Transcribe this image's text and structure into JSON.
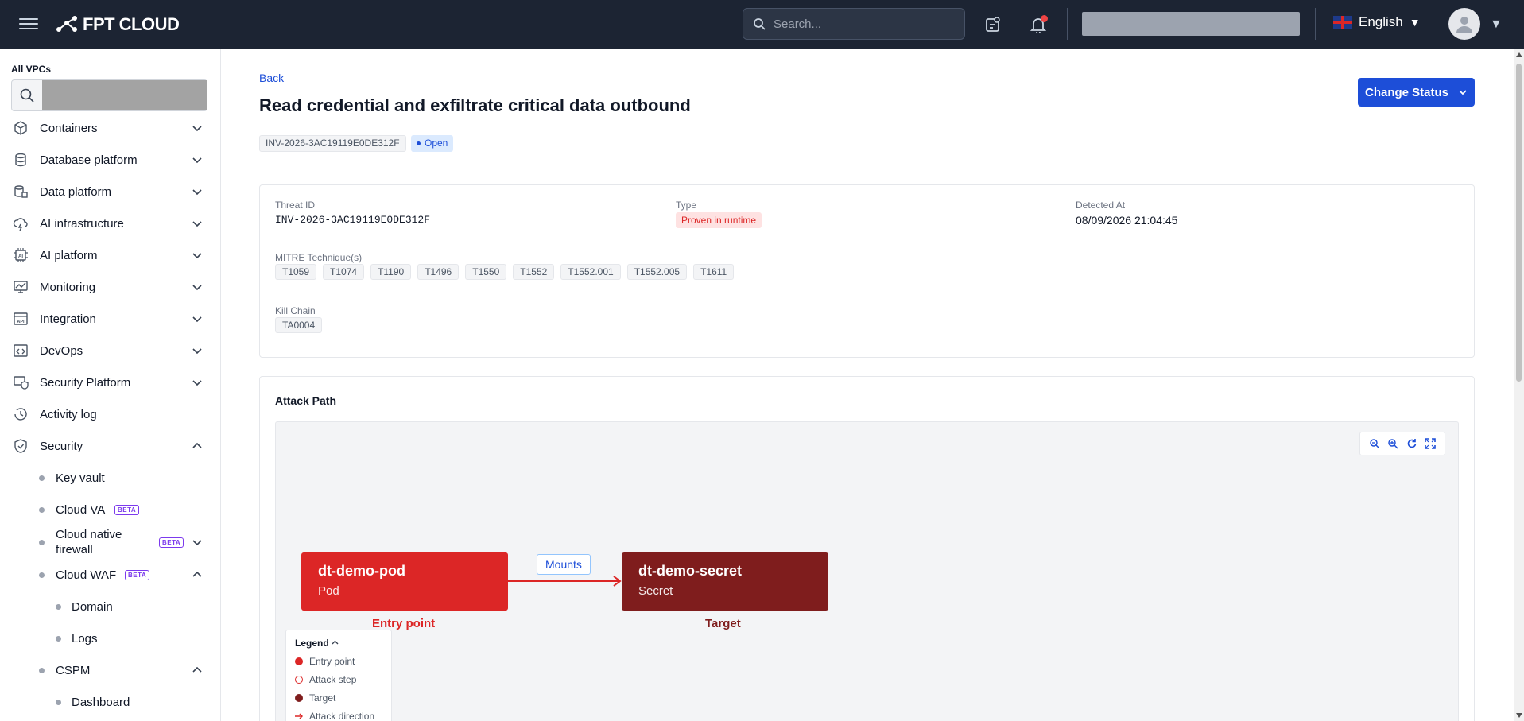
{
  "topbar": {
    "logo_text": "FPT CLOUD",
    "search_placeholder": "Search...",
    "language": "English",
    "notification_color": "#ef4444"
  },
  "sidebar": {
    "vpc_label": "All VPCs",
    "items": [
      {
        "label": "Containers",
        "icon": "cube-icon",
        "expanded": false
      },
      {
        "label": "Database platform",
        "icon": "database-icon",
        "expanded": false
      },
      {
        "label": "Data platform",
        "icon": "data-stack-icon",
        "expanded": false
      },
      {
        "label": "AI infrastructure",
        "icon": "cloud-bolt-icon",
        "expanded": false
      },
      {
        "label": "AI platform",
        "icon": "ai-chip-icon",
        "expanded": false
      },
      {
        "label": "Monitoring",
        "icon": "monitor-chart-icon",
        "expanded": false
      },
      {
        "label": "Integration",
        "icon": "api-icon",
        "expanded": false
      },
      {
        "label": "DevOps",
        "icon": "code-window-icon",
        "expanded": false
      },
      {
        "label": "Security Platform",
        "icon": "security-platform-icon",
        "expanded": false
      },
      {
        "label": "Activity log",
        "icon": "history-icon"
      },
      {
        "label": "Security",
        "icon": "shield-icon",
        "expanded": true
      }
    ],
    "security_children": [
      {
        "label": "Key vault"
      },
      {
        "label": "Cloud VA",
        "badge": "BETA"
      },
      {
        "label": "Cloud native firewall",
        "badge": "BETA"
      },
      {
        "label": "Cloud WAF",
        "badge": "BETA"
      },
      {
        "label": "Domain"
      },
      {
        "label": "Logs"
      },
      {
        "label": "CSPM"
      },
      {
        "label": "Dashboard"
      }
    ]
  },
  "header": {
    "back": "Back",
    "title": "Read credential and exfiltrate critical data outbound",
    "id_chip": "INV-2026-3AC19119E0DE312F",
    "status_chip": "Open",
    "change_status": "Change Status"
  },
  "details": {
    "threat_id_label": "Threat ID",
    "threat_id": "INV-2026-3AC19119E0DE312F",
    "type_label": "Type",
    "type_value": "Proven in runtime",
    "detected_label": "Detected At",
    "detected_value": "08/09/2026 21:04:45",
    "mitre_label": "MITRE Technique(s)",
    "mitre": [
      "T1059",
      "T1074",
      "T1190",
      "T1496",
      "T1550",
      "T1552",
      "T1552.001",
      "T1552.005",
      "T1611"
    ],
    "kill_chain_label": "Kill Chain",
    "kill_chain": [
      "TA0004"
    ]
  },
  "attack_path": {
    "title": "Attack Path",
    "source": {
      "name": "dt-demo-pod",
      "kind": "Pod",
      "caption": "Entry point",
      "color": "#dc2626"
    },
    "target": {
      "name": "dt-demo-secret",
      "kind": "Secret",
      "caption": "Target",
      "color": "#7f1d1d"
    },
    "edge_label": "Mounts",
    "legend": {
      "title": "Legend",
      "items": [
        {
          "label": "Entry point",
          "color": "#dc2626"
        },
        {
          "label": "Attack step",
          "color": "#ffffff"
        },
        {
          "label": "Target",
          "color": "#7f1d1d"
        },
        {
          "label": "Attack direction",
          "color": "#dc2626"
        }
      ]
    }
  },
  "colors": {
    "topbar_bg": "#1c2433",
    "primary": "#1d4ed8",
    "danger": "#dc2626"
  }
}
